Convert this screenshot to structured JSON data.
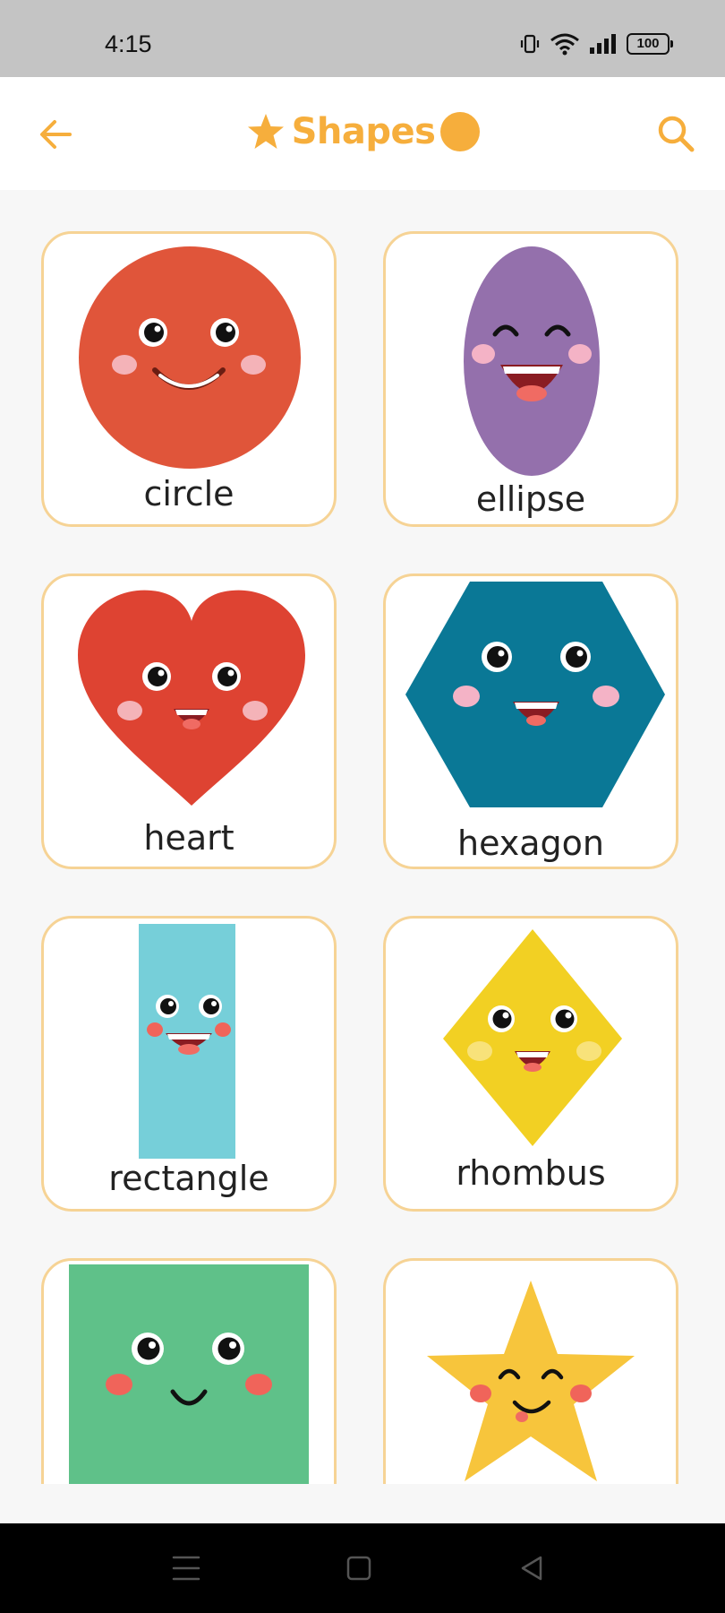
{
  "status_bar": {
    "time": "4:15",
    "battery": "100"
  },
  "app_bar": {
    "title": "Shapes"
  },
  "shapes": [
    {
      "label": "circle",
      "color": "#e0553a"
    },
    {
      "label": "ellipse",
      "color": "#9470ac"
    },
    {
      "label": "heart",
      "color": "#de4332"
    },
    {
      "label": "hexagon",
      "color": "#0a7896"
    },
    {
      "label": "rectangle",
      "color": "#76cfd9"
    },
    {
      "label": "rhombus",
      "color": "#f2d023"
    },
    {
      "label": "square",
      "color": "#5fc189"
    },
    {
      "label": "star",
      "color": "#f7c53c"
    }
  ],
  "colors": {
    "accent": "#f6ae3c",
    "card_border": "#f6d395"
  }
}
